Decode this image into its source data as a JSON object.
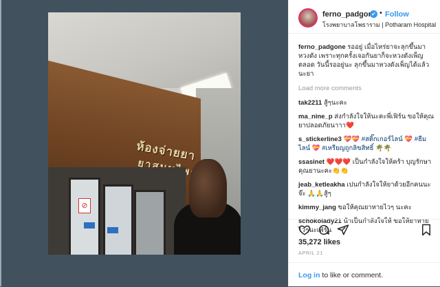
{
  "post": {
    "sign_line1": "ห้องจ่ายยา",
    "sign_line2": "ยาสมุนไพร"
  },
  "header": {
    "username": "ferno_padgone",
    "verified_mark": "✔",
    "separator": "•",
    "follow_label": "Follow",
    "location": "โรงพยาบาลโพธาราม | Potharam Hospital"
  },
  "caption": {
    "user": "ferno_padgone",
    "text": "รออยู่ เมื่อไหร่ยาจะลุกขึ้นมาหวงดัง เพราะทุกครั้งเจอกันยาก็จะหวงดังเพ็ญตลอด วันนี้รออยู่นะ ลุกขึ้นมาหวงดังเพ็ญได้แล้วนะยา"
  },
  "load_more_label": "Load more comments",
  "comments": [
    {
      "user": "tak2211",
      "text": "สู้ๆนะคะ"
    },
    {
      "user": "ma_nine_p",
      "text": "ส่งกำลังใจให้นะคะพี่เฟิร์น ขอให้คุณยาปลอดภัยนาาา❤️"
    },
    {
      "user": "s_stickerline3",
      "text": "💝💝 #สติ๊กเกอร์ไลน์ 💝 #ธีมไลน์ 💝 #เหรียญถูกลิขสิทธิ์ 🌴🌴"
    },
    {
      "user": "ssasinet",
      "text": "❤️❤️❤️ เป็นกำลังใจให้คร้า บุญรักษาคุณยานะคะ👏👏"
    },
    {
      "user": "jeab_ketleakha",
      "text": "เปนกำลังใจให้ยาด้วยอีกคนนะจ๊ะ 🙏🙏สู้ๆ"
    },
    {
      "user": "kimmy_jang",
      "text": "ขอให้คุณยาหายไวๆ นะคะ"
    },
    {
      "user": "schokolady21",
      "text": "น้าเป็นกำลังใจให้ ขอให้ยาหายไวๆนะเฟิร์น"
    }
  ],
  "icons": [
    "heart-icon",
    "comment-icon",
    "share-icon",
    "bookmark-icon"
  ],
  "likes": "35,272 likes",
  "date": "APRIL 21",
  "footer": {
    "login_link": "Log in",
    "login_text": " to like or comment."
  },
  "colors": {
    "link_blue": "#3897f0",
    "page_bg": "#41515d"
  }
}
